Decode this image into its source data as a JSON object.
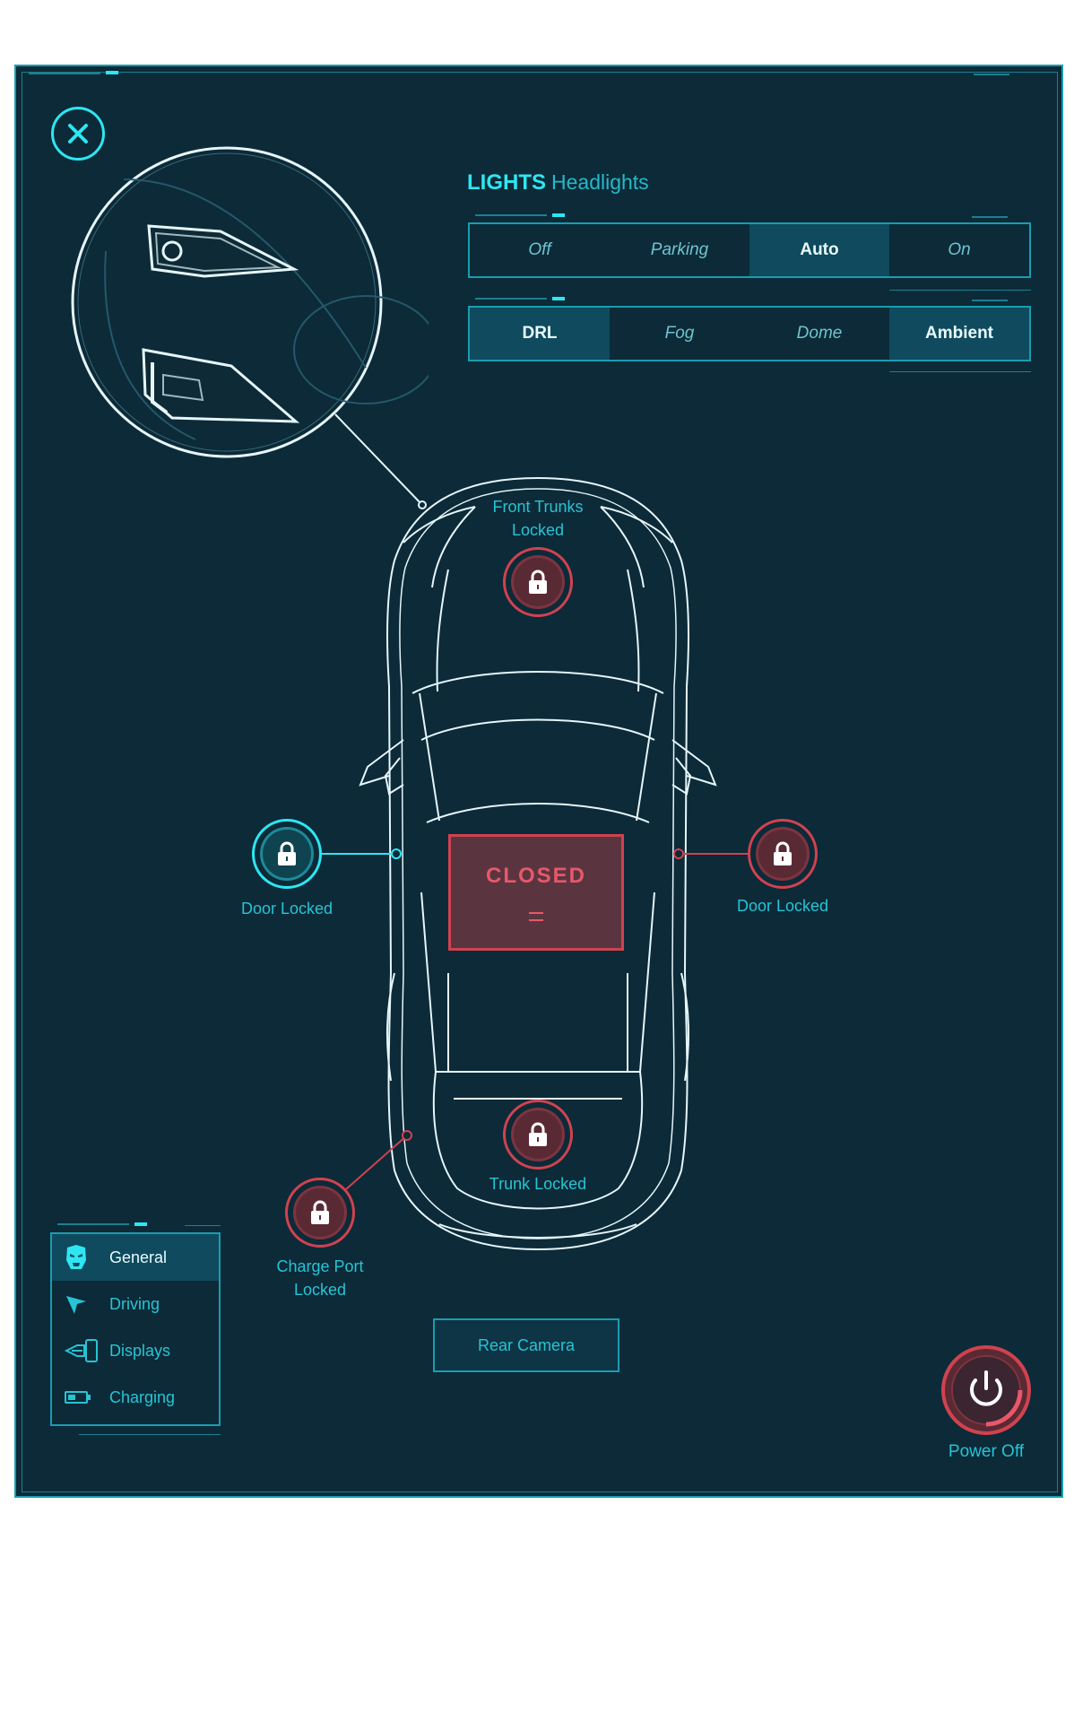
{
  "header": {
    "close_icon": "close-icon",
    "lights_title": "LIGHTS",
    "lights_subtitle": "Headlights"
  },
  "headlight_modes": {
    "options": [
      "Off",
      "Parking",
      "Auto",
      "On"
    ],
    "selected": "Auto"
  },
  "light_types": {
    "options": [
      "DRL",
      "Fog",
      "Dome",
      "Ambient"
    ],
    "selected": [
      "DRL",
      "Ambient"
    ]
  },
  "car": {
    "front_trunk": {
      "label_line1": "Front Trunks",
      "label_line2": "Locked",
      "icon": "lock-icon",
      "state": "locked"
    },
    "left_door": {
      "label": "Door Locked",
      "icon": "lock-icon",
      "state": "locked"
    },
    "right_door": {
      "label": "Door Locked",
      "icon": "lock-icon",
      "state": "locked"
    },
    "sunroof": {
      "label": "CLOSED"
    },
    "trunk": {
      "label": "Trunk Locked",
      "icon": "lock-icon",
      "state": "locked"
    },
    "charge_port": {
      "label_line1": "Charge Port",
      "label_line2": "Locked",
      "icon": "lock-icon",
      "state": "locked"
    }
  },
  "rear_camera": {
    "label": "Rear Camera"
  },
  "nav": {
    "items": [
      {
        "label": "General",
        "icon": "helmet-icon",
        "active": true
      },
      {
        "label": "Driving",
        "icon": "navigation-arrow-icon",
        "active": false
      },
      {
        "label": "Displays",
        "icon": "display-icon",
        "active": false
      },
      {
        "label": "Charging",
        "icon": "battery-icon",
        "active": false
      }
    ]
  },
  "power": {
    "label": "Power Off",
    "icon": "power-icon"
  },
  "colors": {
    "background": "#0c2a38",
    "accent": "#2ee6f2",
    "alert": "#d0424f",
    "active_segment": "#0f4a5e"
  }
}
